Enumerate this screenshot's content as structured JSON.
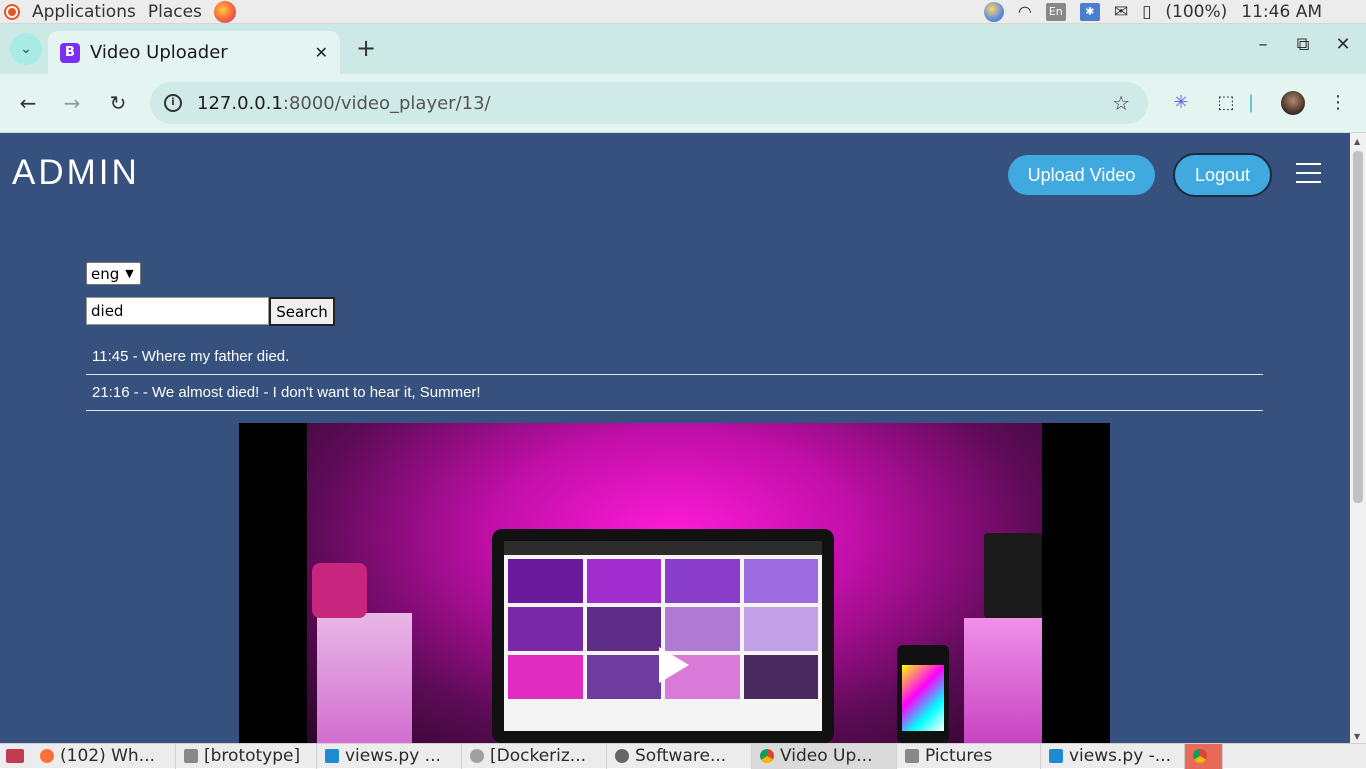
{
  "system_panel": {
    "applications_label": "Applications",
    "places_label": "Places",
    "keyboard_layout": "En",
    "battery": "(100%)",
    "clock": "11:46 AM"
  },
  "browser": {
    "tab_title": "Video Uploader",
    "tab_favicon_letter": "B",
    "url_host": "127.0.0.1",
    "url_rest": ":8000/video_player/13/"
  },
  "page": {
    "brand": "ADMIN",
    "upload_button": "Upload Video",
    "logout_button": "Logout",
    "language_value": "eng",
    "search_value": "died",
    "search_button": "Search",
    "results": [
      {
        "text": "11:45 - Where my father died."
      },
      {
        "text": "21:16 - - We almost died! - I don't want to hear it, Summer!"
      }
    ],
    "colors": {
      "background": "#36517e",
      "button": "#3fa9e0"
    }
  },
  "taskbar": {
    "items": [
      {
        "label": "(102) Wh...",
        "icon": "firefox-icon"
      },
      {
        "label": "[brototype]",
        "icon": "window-icon"
      },
      {
        "label": "views.py ...",
        "icon": "vscode-icon"
      },
      {
        "label": "[Dockeriz...",
        "icon": "chrome-icon"
      },
      {
        "label": "Software...",
        "icon": "software-icon"
      },
      {
        "label": "Video Up...",
        "icon": "chrome-icon"
      },
      {
        "label": "Pictures",
        "icon": "window-icon"
      },
      {
        "label": "views.py -...",
        "icon": "vscode-icon"
      }
    ]
  }
}
